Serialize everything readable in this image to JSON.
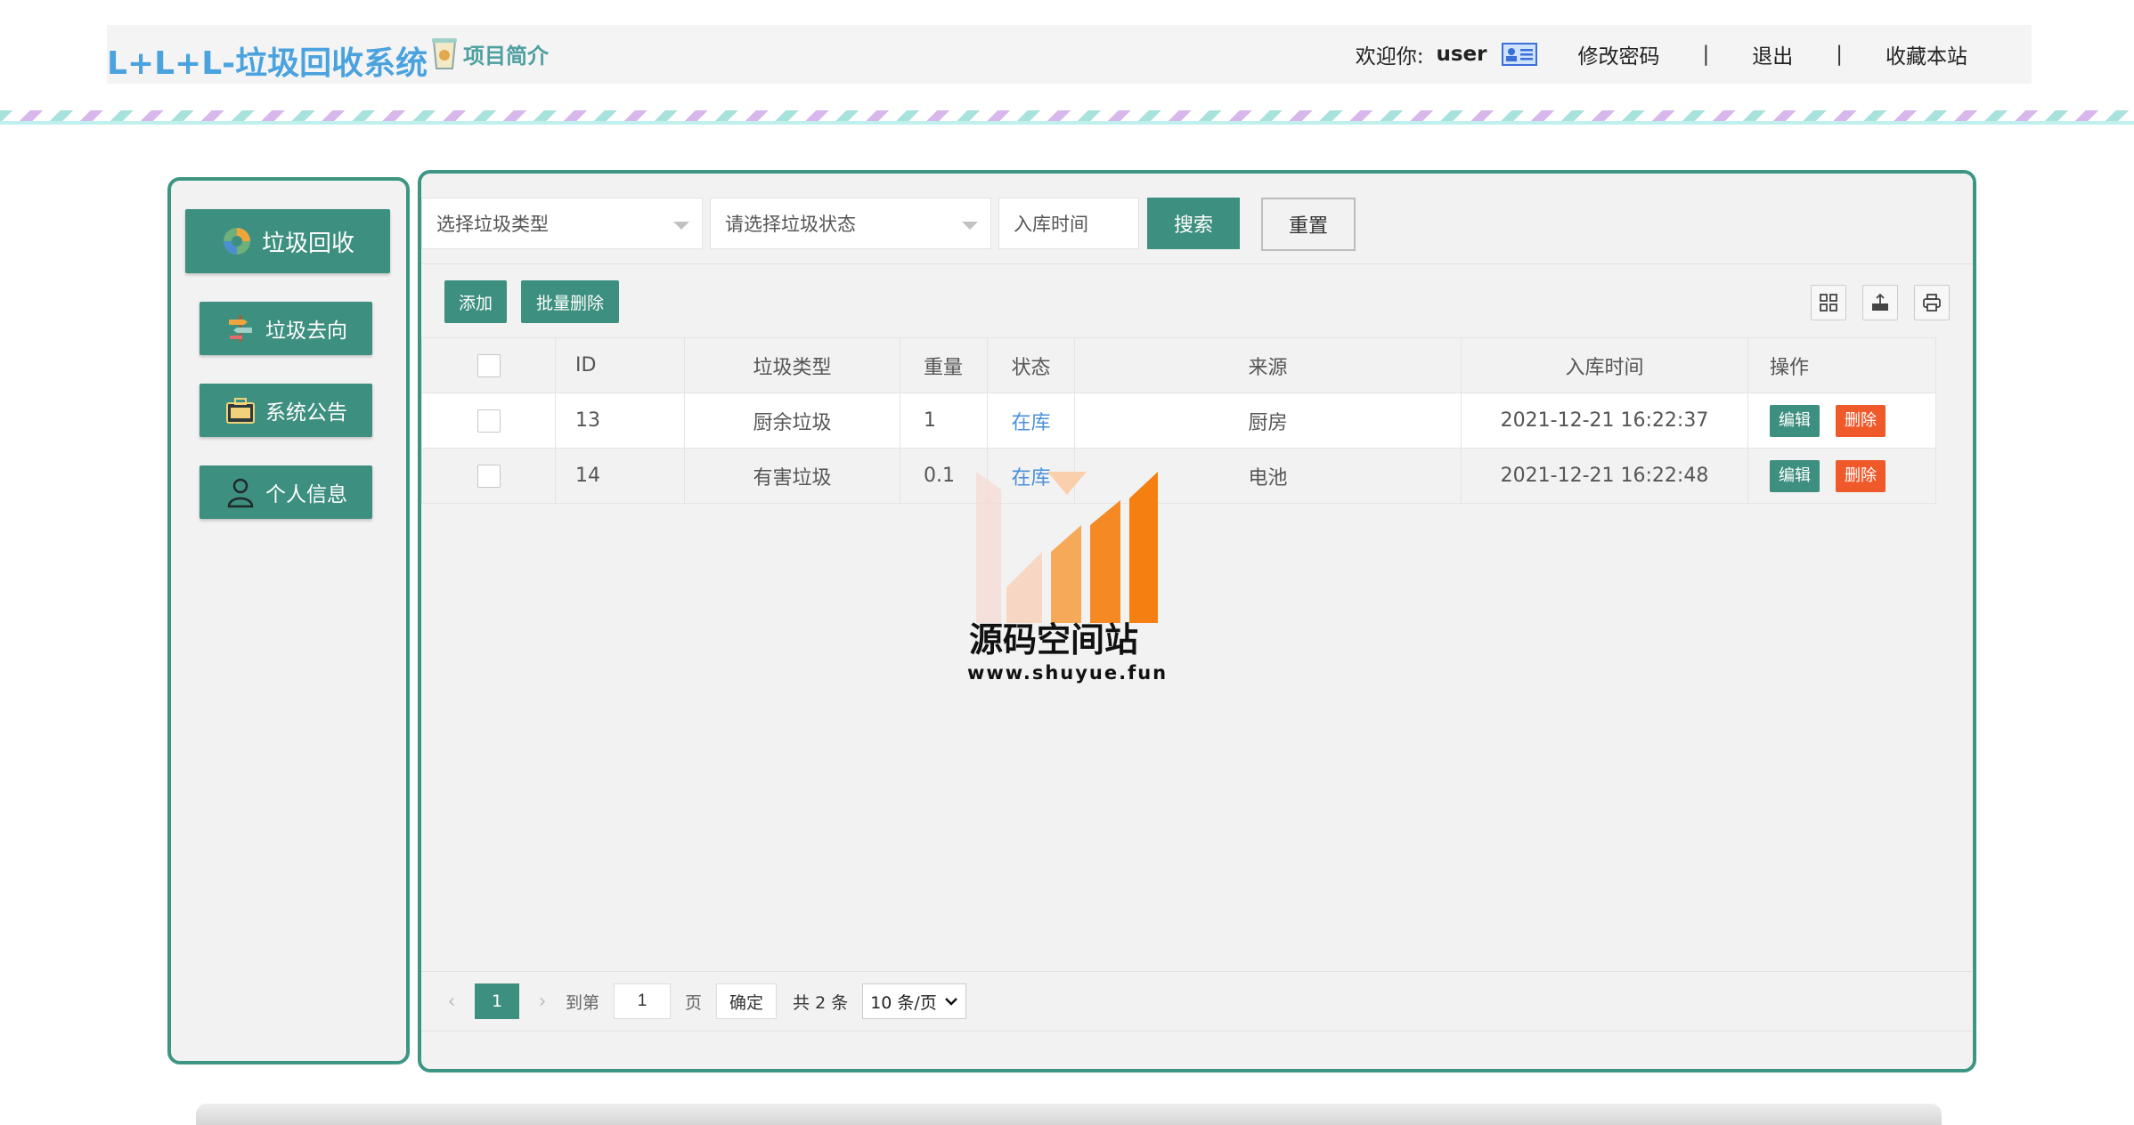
{
  "header": {
    "brand": "L+L+L-垃圾回收系统",
    "intro": "项目简介",
    "welcome": "欢迎你:",
    "username": "user",
    "change_password": "修改密码",
    "sep": "|",
    "logout": "退出",
    "bookmark": "收藏本站"
  },
  "sidebar": {
    "items": [
      {
        "label": "垃圾回收",
        "icon": "recycle-icon"
      },
      {
        "label": "垃圾去向",
        "icon": "signpost-icon"
      },
      {
        "label": "系统公告",
        "icon": "briefcase-icon"
      },
      {
        "label": "个人信息",
        "icon": "person-icon"
      }
    ]
  },
  "filters": {
    "type_placeholder": "选择垃圾类型",
    "status_placeholder": "请选择垃圾状态",
    "time_placeholder": "入库时间",
    "search": "搜索",
    "reset": "重置"
  },
  "toolbar": {
    "add": "添加",
    "batch_delete": "批量删除"
  },
  "table": {
    "columns": [
      "ID",
      "垃圾类型",
      "重量",
      "状态",
      "来源",
      "入库时间",
      "操作"
    ],
    "rows": [
      {
        "id": "13",
        "type": "厨余垃圾",
        "weight": "1",
        "status": "在库",
        "source": "厨房",
        "time": "2021-12-21 16:22:37"
      },
      {
        "id": "14",
        "type": "有害垃圾",
        "weight": "0.1",
        "status": "在库",
        "source": "电池",
        "time": "2021-12-21 16:22:48"
      }
    ],
    "edit": "编辑",
    "delete": "删除"
  },
  "watermark": {
    "title": "源码空间站",
    "url": "www.shuyue.fun"
  },
  "pagination": {
    "current": "1",
    "goto": "到第",
    "page_input": "1",
    "page_unit": "页",
    "confirm": "确定",
    "total": "共 2 条",
    "page_size": "10 条/页"
  },
  "colors": {
    "accent": "#3d8f7f",
    "brand": "#4aa3df",
    "danger": "#f05a2b",
    "link": "#4a90d9"
  }
}
